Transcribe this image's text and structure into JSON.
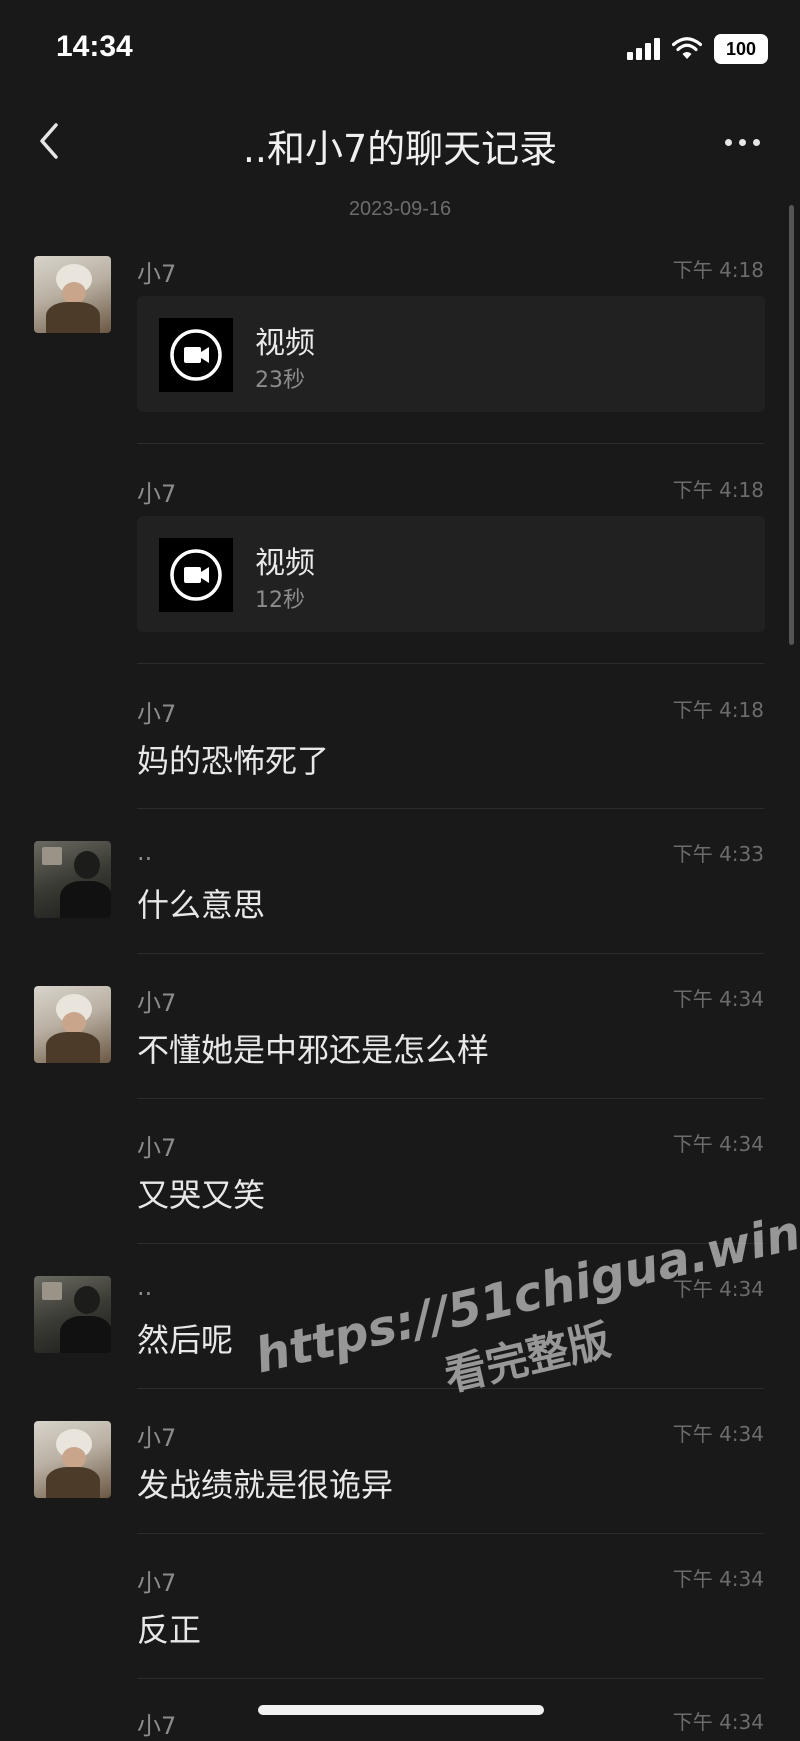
{
  "status_bar": {
    "time": "14:34",
    "battery": "100"
  },
  "header": {
    "title": "..和小7的聊天记录",
    "back_icon": "chevron-left-icon",
    "more_icon": "more-dots-icon"
  },
  "date_separator": "2023-09-16",
  "messages": [
    {
      "sender": "小7",
      "time": "下午 4:18",
      "type": "video",
      "title": "视频",
      "duration": "23秒",
      "avatar": "girl"
    },
    {
      "sender": "小7",
      "time": "下午 4:18",
      "type": "video",
      "title": "视频",
      "duration": "12秒",
      "avatar": ""
    },
    {
      "sender": "小7",
      "time": "下午 4:18",
      "type": "text",
      "text": "妈的恐怖死了",
      "avatar": ""
    },
    {
      "sender": "..",
      "time": "下午 4:33",
      "type": "text",
      "text": "什么意思",
      "avatar": "boy"
    },
    {
      "sender": "小7",
      "time": "下午 4:34",
      "type": "text",
      "text": "不懂她是中邪还是怎么样",
      "avatar": "girl"
    },
    {
      "sender": "小7",
      "time": "下午 4:34",
      "type": "text",
      "text": "又哭又笑",
      "avatar": ""
    },
    {
      "sender": "..",
      "time": "下午 4:34",
      "type": "text",
      "text": "然后呢",
      "avatar": "boy"
    },
    {
      "sender": "小7",
      "time": "下午 4:34",
      "type": "text",
      "text": "发战绩就是很诡异",
      "avatar": "girl"
    },
    {
      "sender": "小7",
      "time": "下午 4:34",
      "type": "text",
      "text": "反正",
      "avatar": ""
    },
    {
      "sender": "小7",
      "time": "下午 4:34",
      "type": "text",
      "text": "",
      "avatar": ""
    }
  ],
  "watermark": {
    "line1": "https://51chigua.win",
    "line2": "看完整版"
  }
}
